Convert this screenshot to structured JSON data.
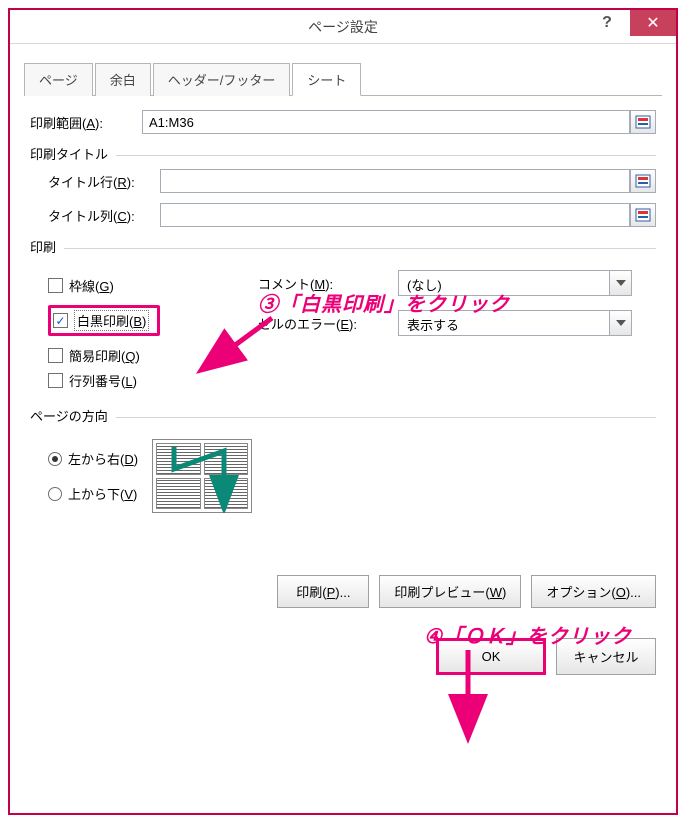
{
  "window": {
    "title": "ページ設定"
  },
  "tabs": [
    "ページ",
    "余白",
    "ヘッダー/フッター",
    "シート"
  ],
  "activeTab": 3,
  "printArea": {
    "label": "印刷範囲",
    "accel": "A",
    "value": "A1:M36"
  },
  "printTitles": {
    "heading": "印刷タイトル",
    "rows": {
      "label": "タイトル行",
      "accel": "R",
      "value": ""
    },
    "cols": {
      "label": "タイトル列",
      "accel": "C",
      "value": ""
    }
  },
  "print": {
    "heading": "印刷",
    "gridlines": {
      "label": "枠線",
      "accel": "G",
      "checked": false
    },
    "bw": {
      "label": "白黒印刷",
      "accel": "B",
      "checked": true
    },
    "draft": {
      "label": "簡易印刷",
      "accel": "Q",
      "checked": false
    },
    "rowcol": {
      "label": "行列番号",
      "accel": "L",
      "checked": false
    },
    "comments": {
      "label": "コメント",
      "accel": "M",
      "value": "(なし)"
    },
    "errors": {
      "label": "セルのエラー",
      "accel": "E",
      "value": "表示する"
    }
  },
  "order": {
    "heading": "ページの方向",
    "ltr": {
      "label": "左から右",
      "accel": "D",
      "selected": true
    },
    "ttb": {
      "label": "上から下",
      "accel": "V",
      "selected": false
    }
  },
  "buttons": {
    "print": {
      "label": "印刷",
      "accel": "P"
    },
    "preview": {
      "label": "印刷プレビュー",
      "accel": "W"
    },
    "options": {
      "label": "オプション",
      "accel": "O"
    },
    "ok": "OK",
    "cancel": "キャンセル"
  },
  "annotations": {
    "a3": "③「白黒印刷」をクリック",
    "a4": "④「ＯＫ」をクリック"
  }
}
